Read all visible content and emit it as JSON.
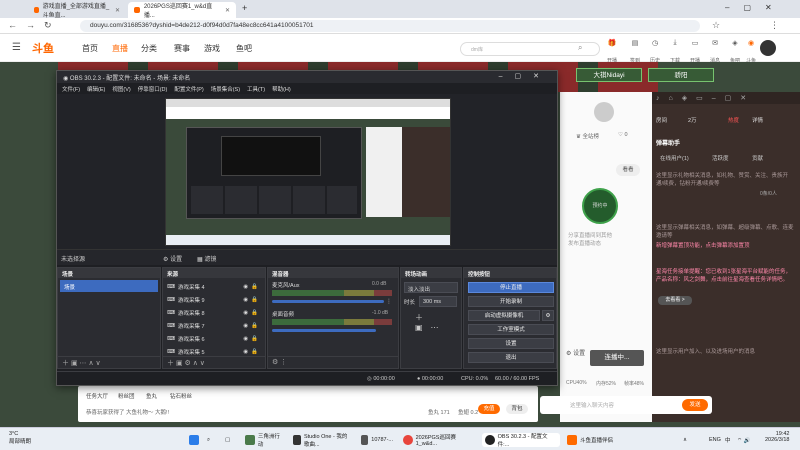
{
  "browser": {
    "tabs": [
      {
        "label": "游戏直播_全部游戏直播_斗鱼直...",
        "active": false
      },
      {
        "label": "2026PGS巡回赛1_w&d直播...",
        "active": true
      }
    ],
    "new_tab": "+",
    "url": "douyu.com/3168536?dyshid=b4de212-d0f94d0d7fa48ec8cc641a4100051701"
  },
  "site": {
    "logo": "斗鱼",
    "nav": [
      "首页",
      "直播",
      "分类",
      "赛事",
      "游戏",
      "鱼吧"
    ],
    "search_placeholder": "dm库",
    "top_icons": [
      "开播福利",
      "签到",
      "历史",
      "下载",
      "开播",
      "消息",
      "鱼吧",
      "斗鱼"
    ],
    "banner_tags": [
      "大祺Nidayi",
      "骄阳"
    ]
  },
  "site_right": {
    "follow_label": "全站榜",
    "likes": "0",
    "watch_label": "看看",
    "center_tag": "预约中",
    "stats": [
      "0",
      "0"
    ],
    "cpu": "CPU40%",
    "mem": "内存52%",
    "bitrate": "帧率48%",
    "settings": "设置",
    "go_live": "连播中...",
    "hint_lines": [
      "分享直播间到其他",
      "发布直播动态"
    ]
  },
  "live_panel": {
    "tabs": [
      "房间",
      "2万",
      "热度",
      "详情"
    ],
    "section": "弹幕助手",
    "sub_tabs": [
      "在线用户(1)",
      "活跃度",
      "贡献"
    ],
    "messages": [
      "这里显示礼物相关消息，如礼物、赞赏、关注、贵族开通/续费，钻粉开通/续费等",
      "这里显示弹幕相关消息，如弹幕、超级弹幕、点歌、连麦邀请等",
      "新增弹幕置顶功能，点击弹幕添加置顶",
      "星海任务接单提醒：您已收到1张星海平台赋能的任务，产品名称：风之剑舞，点击前往星海查看任务详情吧。",
      "这里显示用户加入、以及进场用户的消息"
    ],
    "fold_label": "去看看 >",
    "count_label": "0条/0人",
    "input_placeholder": "这里输入聊天内容",
    "send": "发送"
  },
  "obs": {
    "title": "OBS 30.2.3 - 配置文件: 未命名 - 场景: 未命名",
    "menu": [
      "文件(F)",
      "编辑(E)",
      "视图(V)",
      "停靠窗口(D)",
      "配置文件(P)",
      "场景集合(S)",
      "工具(T)",
      "帮助(H)"
    ],
    "source_label": "未选择源",
    "props_btn": "设置",
    "filter_btn": "滤镜",
    "docks": {
      "scenes": {
        "title": "场景",
        "items": [
          "场景"
        ]
      },
      "sources": {
        "title": "来源",
        "items": [
          "游戏采集 4",
          "游戏采集 9",
          "游戏采集 8",
          "游戏采集 7",
          "游戏采集 6",
          "游戏采集 5"
        ]
      },
      "mixer": {
        "title": "混音器",
        "channels": [
          {
            "name": "麦克风/Aux",
            "db": "0.0 dB"
          },
          {
            "name": "桌面音频",
            "db": "-1.0 dB"
          }
        ]
      },
      "transitions": {
        "title": "转场动画",
        "type": "淡入淡出",
        "duration_label": "时长",
        "duration": "300 ms"
      },
      "controls": {
        "title": "控制按钮",
        "buttons": [
          "停止直播",
          "开始录制",
          "启动虚拟摄像机",
          "工作室模式",
          "设置",
          "退出"
        ]
      }
    },
    "status": {
      "live_time": "00:00:00",
      "rec_time": "00:00:00",
      "cpu": "CPU: 0.0%",
      "fps": "60.00 / 60.00 FPS"
    }
  },
  "stream_bottom": {
    "gifts": [
      "任务大厅",
      "粉丝团",
      "鱼丸",
      "钻石粉丝"
    ],
    "notice": "恭喜玩家获得了 大鱼礼物～ 大鹅!!",
    "fish_ball": "鱼丸 171",
    "fish_fin": "鱼翅 0.2",
    "buttons": [
      "充值",
      "背包"
    ]
  },
  "taskbar": {
    "weather_temp": "3°C",
    "weather_desc": "局部晴朗",
    "apps": [
      "三角洲行动",
      "Studio One - 我的歌曲...",
      "10787-...",
      "2026PGS巡回赛1_w&d...",
      "OBS 30.2.3 - 配置文件:...",
      "斗鱼直播伴侣"
    ],
    "lang": "ENG",
    "ime": "中",
    "time": "19:42",
    "date": "2026/3/18"
  },
  "colors": {
    "douyu_orange": "#ff6a00",
    "obs_bg": "#1e1f23",
    "obs_active": "#3d6bbf",
    "live_panel_bg": "#3b2e2a"
  }
}
